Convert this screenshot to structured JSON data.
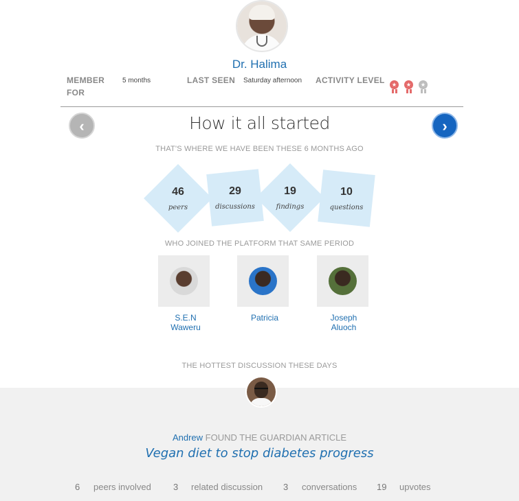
{
  "profile": {
    "name": "Dr. Halima",
    "member_for_label": "MEMBER FOR",
    "member_for_value": "5 months",
    "last_seen_label": "LAST SEEN",
    "last_seen_value": "Saturday afternoon",
    "activity_label": "ACTIVITY LEVEL",
    "activity_level": 2,
    "activity_max": 3
  },
  "section": {
    "title": "How it all started",
    "stats_caption": "THAT'S WHERE WE HAVE BEEN THESE 6 MONTHS AGO",
    "stats": [
      {
        "value": "46",
        "label": "peers"
      },
      {
        "value": "29",
        "label": "discussions"
      },
      {
        "value": "19",
        "label": "findings"
      },
      {
        "value": "10",
        "label": "questions"
      }
    ],
    "members_caption": "WHO JOINED THE PLATFORM THAT SAME PERIOD",
    "members": [
      {
        "line1": "S.E.N",
        "line2": "Waweru"
      },
      {
        "line1": "Patricia",
        "line2": ""
      },
      {
        "line1": "Joseph",
        "line2": "Aluoch"
      }
    ]
  },
  "hottest": {
    "caption": "THE HOTTEST DISCUSSION THESE DAYS",
    "who": "Andrew",
    "action": "FOUND THE GUARDIAN ARTICLE",
    "title": "Vegan diet to stop diabetes progress",
    "stats": [
      {
        "value": "6",
        "label": "peers involved"
      },
      {
        "value": "3",
        "label": "related discussion"
      },
      {
        "value": "3",
        "label": "conversations"
      },
      {
        "value": "19",
        "label": "upvotes"
      }
    ]
  },
  "colors": {
    "accent": "#1f6fb0",
    "next_button": "#1565c0",
    "prev_button": "#b5b5b5",
    "stat_tile": "#d6ebf8",
    "medal_on": "#e46a6a",
    "medal_off": "#bdbdbd"
  },
  "icons": {
    "prev": "chevron-left-icon",
    "next": "chevron-right-icon",
    "medal": "medal-icon"
  }
}
